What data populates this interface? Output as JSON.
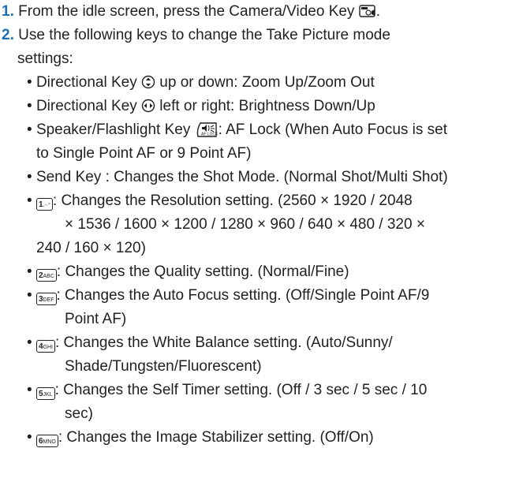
{
  "step1": {
    "num": "1.",
    "text": "From the idle screen, press the Camera/Video Key",
    "tail": "."
  },
  "step2": {
    "num": "2.",
    "line1": "Use the following keys to change the Take Picture mode",
    "line2": "settings:"
  },
  "bullets": {
    "b1_pre": "Directional Key",
    "b1_post": "up or down: Zoom Up/Zoom Out",
    "b2_pre": "Directional Key",
    "b2_post": "left or right: Brightness Down/Up",
    "b3_pre": "Speaker/Flashlight Key",
    "b3_post": ": AF Lock (When Auto Focus is set",
    "b3_line2": "to Single Point AF or 9 Point AF)",
    "b4": "Send Key : Changes the Shot Mode. (Normal Shot/Multi Shot)",
    "b5_key": "1",
    "b5_line1": ": Changes the Resolution setting. (2560 × 1920 / 2048",
    "b5_line2": "× 1536 / 1600 × 1200 / 1280 × 960 / 640 × 480 / 320 ×",
    "b5_line3": "240 / 160 × 120)",
    "b6_key": "2",
    "b6_key_sub": "ABC",
    "b6_line1": ": Changes the Quality setting. (Normal/Fine)",
    "b7_key": "3",
    "b7_key_sub": "DEF",
    "b7_line1": ": Changes the Auto Focus setting. (Off/Single Point AF/9",
    "b7_line2": "Point AF)",
    "b8_key": "4",
    "b8_key_sub": "GHI",
    "b8_line1": ": Changes the White Balance setting. (Auto/Sunny/",
    "b8_line2": "Shade/Tungsten/Fluorescent)",
    "b9_key": "5",
    "b9_key_sub": "JKL",
    "b9_line1": ": Changes the Self Timer setting. (Off / 3 sec / 5 sec / 10",
    "b9_line2": "sec)",
    "b10_key": "6",
    "b10_key_sub": "MNO",
    "b10_line1": ": Changes the Image Stabilizer setting. (Off/On)"
  },
  "icons": {
    "camera": "camera-video-key-icon",
    "nav_updown": "directional-key-updown-icon",
    "nav_leftright": "directional-key-leftright-icon",
    "af_lock": "speaker-flashlight-key-icon"
  },
  "colors": {
    "step_number": "#1d6fb3",
    "text": "#231f20"
  }
}
